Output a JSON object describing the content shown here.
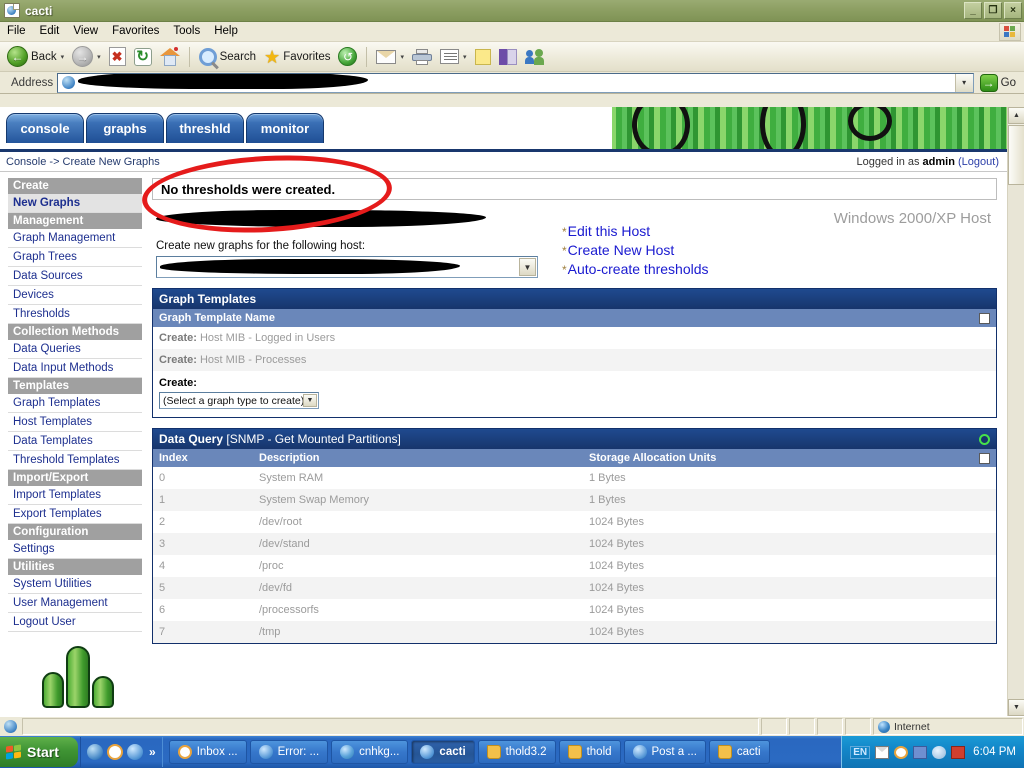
{
  "window": {
    "title": "cacti",
    "icon": "browser-page-icon",
    "minimize_label": "_",
    "restore_label": "❐",
    "close_label": "×"
  },
  "menubar": {
    "items": [
      "File",
      "Edit",
      "View",
      "Favorites",
      "Tools",
      "Help"
    ]
  },
  "toolbar": {
    "back_label": "Back",
    "search_label": "Search",
    "favorites_label": "Favorites",
    "dropdown_caret": "▾"
  },
  "address": {
    "label": "Address",
    "value": "",
    "go_label": "Go",
    "go_arrow": "→",
    "dropdown_caret": "▾"
  },
  "page": {
    "tabs": [
      {
        "label": "console",
        "active": true
      },
      {
        "label": "graphs",
        "active": false
      },
      {
        "label": "threshld",
        "active": false
      },
      {
        "label": "monitor",
        "active": false
      }
    ],
    "breadcrumb": "Console -> Create New Graphs",
    "login_prefix": "Logged in as ",
    "login_user": "admin",
    "login_logout": "(Logout)",
    "message": "No thresholds were created.",
    "host_type": "Windows 2000/XP Host",
    "create_for_label": "Create new graphs for the following host:",
    "host_select_value": "",
    "action_links": [
      {
        "bullet": "*",
        "label": "Edit this Host"
      },
      {
        "bullet": "*",
        "label": "Create New Host"
      },
      {
        "bullet": "*",
        "label": "Auto-create thresholds"
      }
    ]
  },
  "sidebar": {
    "items": [
      {
        "label": "Create",
        "type": "section"
      },
      {
        "label": "New Graphs",
        "type": "link-strong"
      },
      {
        "label": "Management",
        "type": "section"
      },
      {
        "label": "Graph Management",
        "type": "link"
      },
      {
        "label": "Graph Trees",
        "type": "link"
      },
      {
        "label": "Data Sources",
        "type": "link"
      },
      {
        "label": "Devices",
        "type": "link"
      },
      {
        "label": "Thresholds",
        "type": "link"
      },
      {
        "label": "Collection Methods",
        "type": "section"
      },
      {
        "label": "Data Queries",
        "type": "link"
      },
      {
        "label": "Data Input Methods",
        "type": "link"
      },
      {
        "label": "Templates",
        "type": "section"
      },
      {
        "label": "Graph Templates",
        "type": "link"
      },
      {
        "label": "Host Templates",
        "type": "link"
      },
      {
        "label": "Data Templates",
        "type": "link"
      },
      {
        "label": "Threshold Templates",
        "type": "link"
      },
      {
        "label": "Import/Export",
        "type": "section"
      },
      {
        "label": "Import Templates",
        "type": "link"
      },
      {
        "label": "Export Templates",
        "type": "link"
      },
      {
        "label": "Configuration",
        "type": "section"
      },
      {
        "label": "Settings",
        "type": "link"
      },
      {
        "label": "Utilities",
        "type": "section"
      },
      {
        "label": "System Utilities",
        "type": "link"
      },
      {
        "label": "User Management",
        "type": "link"
      },
      {
        "label": "Logout User",
        "type": "link"
      }
    ]
  },
  "graph_templates": {
    "panel_title": "Graph Templates",
    "column_header": "Graph Template Name",
    "rows": [
      {
        "prefix": "Create:",
        "name": "Host MIB - Logged in Users"
      },
      {
        "prefix": "Create:",
        "name": "Host MIB - Processes"
      }
    ],
    "create_label": "Create:",
    "create_select_value": "(Select a graph type to create)"
  },
  "data_query": {
    "panel_title": "Data Query ",
    "panel_subtitle": "[SNMP - Get Mounted Partitions]",
    "columns": [
      "Index",
      "Description",
      "Storage Allocation Units"
    ],
    "rows": [
      {
        "index": "0",
        "description": "System RAM",
        "units": "1 Bytes"
      },
      {
        "index": "1",
        "description": "System Swap Memory",
        "units": "1 Bytes"
      },
      {
        "index": "2",
        "description": "/dev/root",
        "units": "1024 Bytes"
      },
      {
        "index": "3",
        "description": "/dev/stand",
        "units": "1024 Bytes"
      },
      {
        "index": "4",
        "description": "/proc",
        "units": "1024 Bytes"
      },
      {
        "index": "5",
        "description": "/dev/fd",
        "units": "1024 Bytes"
      },
      {
        "index": "6",
        "description": "/processorfs",
        "units": "1024 Bytes"
      },
      {
        "index": "7",
        "description": "/tmp",
        "units": "1024 Bytes"
      }
    ]
  },
  "statusbar": {
    "zone": "Internet"
  },
  "taskbar": {
    "start_label": "Start",
    "quicklaunch_chevron": "»",
    "tasks": [
      {
        "label": "Inbox ...",
        "icon": "clock-icon",
        "active": false
      },
      {
        "label": "Error: ...",
        "icon": "ie-icon",
        "active": false
      },
      {
        "label": "cnhkg...",
        "icon": "globe-icon",
        "active": false
      },
      {
        "label": "cacti",
        "icon": "ie-icon",
        "active": true
      },
      {
        "label": "thold3.2",
        "icon": "folder-icon",
        "active": false
      },
      {
        "label": "thold",
        "icon": "folder-icon",
        "active": false
      },
      {
        "label": "Post a ...",
        "icon": "ie-icon",
        "active": false
      },
      {
        "label": "cacti",
        "icon": "folder-icon",
        "active": false
      }
    ],
    "tray_language": "EN",
    "clock": "6:04 PM"
  },
  "colors": {
    "accent_blue": "#17356c",
    "header_blue": "#6a87ba",
    "link_blue": "#1d2f8f",
    "annotation_red": "#e51b1b",
    "title_olive": "#8d9f63"
  }
}
